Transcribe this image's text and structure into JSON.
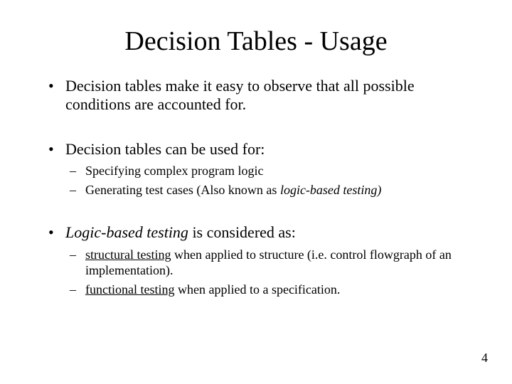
{
  "title": "Decision Tables - Usage",
  "bullets": {
    "b1": "Decision tables make it easy to observe that all possible conditions are accounted for.",
    "b2": "Decision tables can be used for:",
    "b2_sub1": "Specifying complex program logic",
    "b2_sub2_a": "Generating test cases (Also known as ",
    "b2_sub2_b": "logic-based testing)",
    "b3_a": "Logic-based testing",
    "b3_b": " is considered as:",
    "b3_sub1_a": "structural testing",
    "b3_sub1_b": " when applied to structure (i.e. control flowgraph of an implementation).",
    "b3_sub2_a": "functional testing",
    "b3_sub2_b": " when applied to a specification."
  },
  "page_number": "4"
}
